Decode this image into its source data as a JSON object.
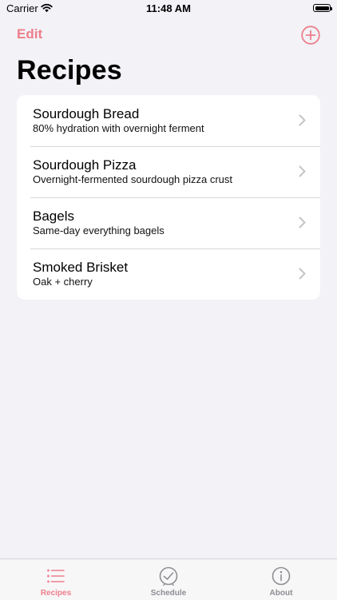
{
  "status_bar": {
    "carrier": "Carrier",
    "time": "11:48 AM"
  },
  "nav": {
    "edit_label": "Edit",
    "add_icon": "plus-circle-icon"
  },
  "title": "Recipes",
  "recipes": [
    {
      "name": "Sourdough Bread",
      "description": "80% hydration with overnight ferment"
    },
    {
      "name": "Sourdough Pizza",
      "description": "Overnight-fermented sourdough pizza crust"
    },
    {
      "name": "Bagels",
      "description": "Same-day everything bagels"
    },
    {
      "name": "Smoked Brisket",
      "description": "Oak + cherry"
    }
  ],
  "tabs": [
    {
      "label": "Recipes",
      "icon": "list-icon",
      "active": true
    },
    {
      "label": "Schedule",
      "icon": "clock-icon",
      "active": false
    },
    {
      "label": "About",
      "icon": "info-icon",
      "active": false
    }
  ],
  "colors": {
    "accent": "#ee7e8a",
    "background": "#f2f2f7",
    "inactive": "#8e8e93"
  }
}
